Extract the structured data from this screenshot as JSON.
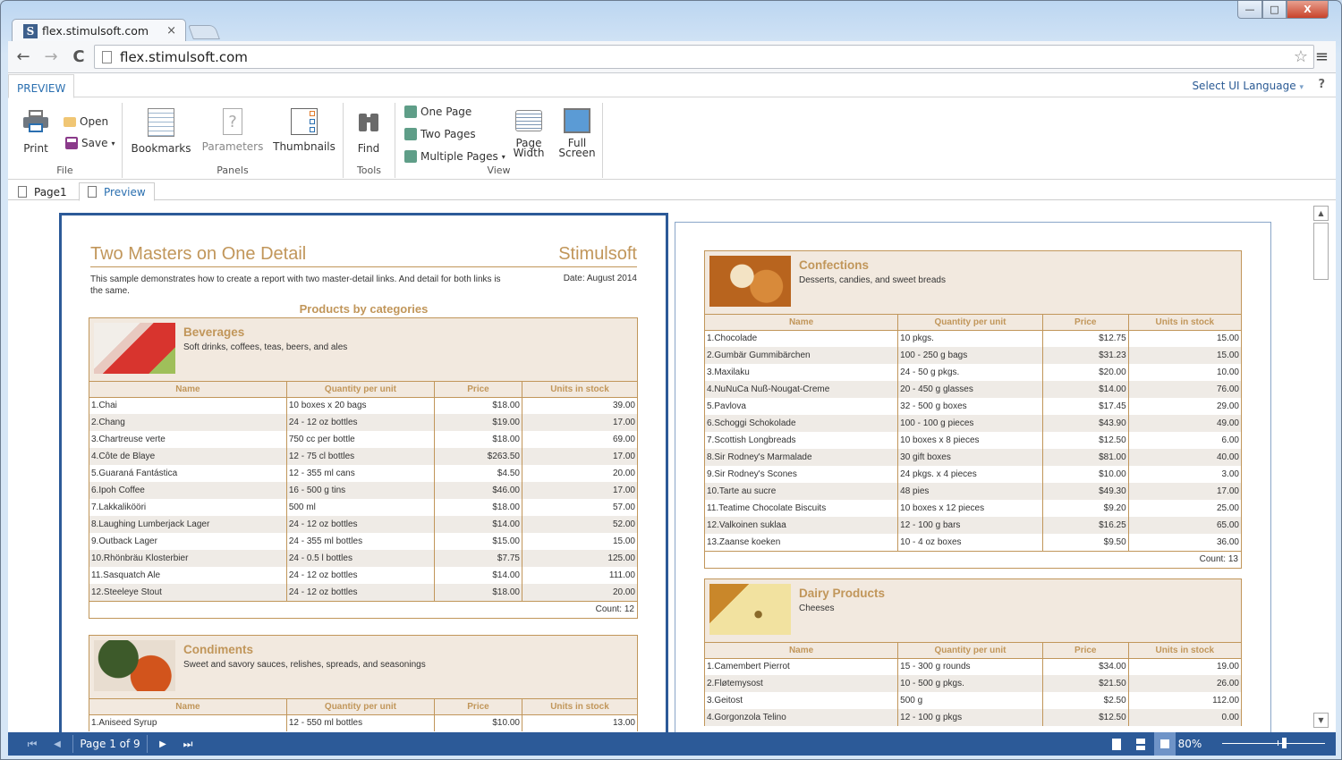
{
  "browser": {
    "tab_title": "flex.stimulsoft.com",
    "tab_close": "×",
    "favicon_letter": "S",
    "address": "flex.stimulsoft.com",
    "back_icon": "←",
    "forward_icon": "→",
    "reload_icon": "C",
    "star_icon": "☆",
    "menu_icon": "≡",
    "window_min": "—",
    "window_max": "□",
    "window_close": "X"
  },
  "ribbon": {
    "tab": "PREVIEW",
    "language_label": "Select UI Language",
    "language_caret": "▾",
    "help_label": "?",
    "groups": {
      "file": {
        "label": "File",
        "print": "Print",
        "open": "Open",
        "save": "Save",
        "save_caret": "▾"
      },
      "panels": {
        "label": "Panels",
        "bookmarks": "Bookmarks",
        "parameters": "Parameters",
        "thumbnails": "Thumbnails"
      },
      "tools": {
        "label": "Tools",
        "find": "Find"
      },
      "view": {
        "label": "View",
        "one_page": "One Page",
        "two_pages": "Two Pages",
        "multiple_pages": "Multiple Pages",
        "multiple_caret": "▾",
        "page_width_1": "Page",
        "page_width_2": "Width",
        "full_screen_1": "Full",
        "full_screen_2": "Screen"
      }
    }
  },
  "doc_tabs": [
    {
      "label": "Page1",
      "active": false
    },
    {
      "label": "Preview",
      "active": true
    }
  ],
  "report": {
    "title": "Two Masters on One Detail",
    "brand": "Stimulsoft",
    "description": "This sample demonstrates how to create a report with two master-detail links. And detail for both links is the same.",
    "date": "Date: August 2014",
    "subtitle": "Products by categories",
    "columns": [
      "Name",
      "Quantity per unit",
      "Price",
      "Units in stock"
    ],
    "categories": [
      {
        "name": "Beverages",
        "description": "Soft drinks, coffees, teas, beers, and ales",
        "count": "Count: 12",
        "rows": [
          [
            "1.Chai",
            "10 boxes x 20 bags",
            "$18.00",
            "39.00"
          ],
          [
            "2.Chang",
            "24 - 12 oz bottles",
            "$19.00",
            "17.00"
          ],
          [
            "3.Chartreuse verte",
            "750 cc per bottle",
            "$18.00",
            "69.00"
          ],
          [
            "4.Côte de Blaye",
            "12 - 75 cl bottles",
            "$263.50",
            "17.00"
          ],
          [
            "5.Guaraná Fantástica",
            "12 - 355 ml cans",
            "$4.50",
            "20.00"
          ],
          [
            "6.Ipoh Coffee",
            "16 - 500 g tins",
            "$46.00",
            "17.00"
          ],
          [
            "7.Lakkalikööri",
            "500 ml",
            "$18.00",
            "57.00"
          ],
          [
            "8.Laughing Lumberjack Lager",
            "24 - 12 oz bottles",
            "$14.00",
            "52.00"
          ],
          [
            "9.Outback Lager",
            "24 - 355 ml bottles",
            "$15.00",
            "15.00"
          ],
          [
            "10.Rhönbräu Klosterbier",
            "24 - 0.5 l bottles",
            "$7.75",
            "125.00"
          ],
          [
            "11.Sasquatch Ale",
            "24 - 12 oz bottles",
            "$14.00",
            "111.00"
          ],
          [
            "12.Steeleye Stout",
            "24 - 12 oz bottles",
            "$18.00",
            "20.00"
          ]
        ]
      },
      {
        "name": "Condiments",
        "description": "Sweet and savory sauces, relishes, spreads, and seasonings",
        "rows": [
          [
            "1.Aniseed Syrup",
            "12 - 550 ml bottles",
            "$10.00",
            "13.00"
          ]
        ]
      },
      {
        "name": "Confections",
        "description": "Desserts, candies, and sweet breads",
        "count": "Count: 13",
        "rows": [
          [
            "1.Chocolade",
            "10 pkgs.",
            "$12.75",
            "15.00"
          ],
          [
            "2.Gumbär Gummibärchen",
            "100 - 250 g bags",
            "$31.23",
            "15.00"
          ],
          [
            "3.Maxilaku",
            "24 - 50 g pkgs.",
            "$20.00",
            "10.00"
          ],
          [
            "4.NuNuCa Nuß-Nougat-Creme",
            "20 - 450 g glasses",
            "$14.00",
            "76.00"
          ],
          [
            "5.Pavlova",
            "32 - 500 g boxes",
            "$17.45",
            "29.00"
          ],
          [
            "6.Schoggi Schokolade",
            "100 - 100 g pieces",
            "$43.90",
            "49.00"
          ],
          [
            "7.Scottish Longbreads",
            "10 boxes x 8 pieces",
            "$12.50",
            "6.00"
          ],
          [
            "8.Sir Rodney's Marmalade",
            "30 gift boxes",
            "$81.00",
            "40.00"
          ],
          [
            "9.Sir Rodney's Scones",
            "24 pkgs. x 4 pieces",
            "$10.00",
            "3.00"
          ],
          [
            "10.Tarte au sucre",
            "48 pies",
            "$49.30",
            "17.00"
          ],
          [
            "11.Teatime Chocolate Biscuits",
            "10 boxes x 12 pieces",
            "$9.20",
            "25.00"
          ],
          [
            "12.Valkoinen suklaa",
            "12 - 100 g bars",
            "$16.25",
            "65.00"
          ],
          [
            "13.Zaanse koeken",
            "10 - 4 oz boxes",
            "$9.50",
            "36.00"
          ]
        ]
      },
      {
        "name": "Dairy Products",
        "description": "Cheeses",
        "rows": [
          [
            "1.Camembert Pierrot",
            "15 - 300 g rounds",
            "$34.00",
            "19.00"
          ],
          [
            "2.Fløtemysost",
            "10 - 500 g pkgs.",
            "$21.50",
            "26.00"
          ],
          [
            "3.Geitost",
            "500 g",
            "$2.50",
            "112.00"
          ],
          [
            "4.Gorgonzola Telino",
            "12 - 100 g pkgs",
            "$12.50",
            "0.00"
          ]
        ]
      }
    ]
  },
  "status": {
    "first_icon": "⏮",
    "prev_icon": "◀",
    "page_label": "Page 1 of 9",
    "next_icon": "▶",
    "last_icon": "⏭",
    "zoom_label": "80%",
    "zoom_value_percent": 80
  },
  "colors": {
    "accent_blue": "#2c5a98",
    "report_brown": "#c1965a",
    "category_bg": "#f2e9df"
  }
}
